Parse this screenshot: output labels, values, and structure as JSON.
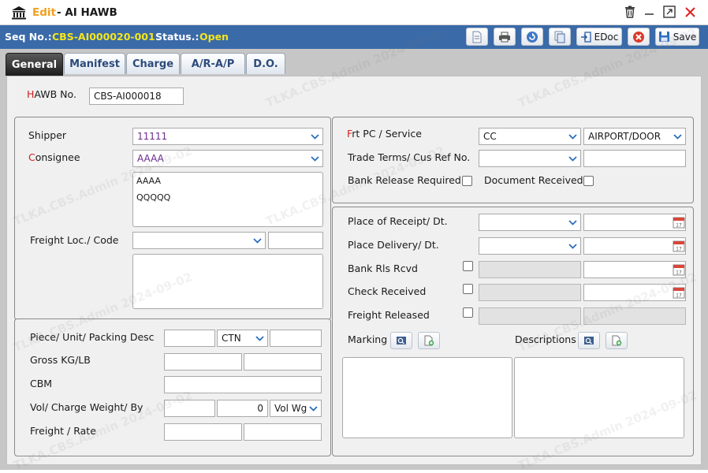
{
  "window": {
    "mode_label": "Edit",
    "title_sep": " - ",
    "title": "AI HAWB",
    "icon": "bank-icon"
  },
  "window_controls": {
    "delete_icon": "trash-icon",
    "minimize_icon": "minimize-icon",
    "maximize_icon": "maximize-icon",
    "close_icon": "close-icon"
  },
  "seqbar": {
    "seq_label": "Seq No.:",
    "seq_value": "CBS-AI000020-001",
    "status_label": "Status.:",
    "status_value": "Open"
  },
  "toolbar": {
    "edoc_label": "EDoc",
    "save_label": "Save"
  },
  "tabs": [
    {
      "label": "General",
      "active": true
    },
    {
      "label": "Manifest"
    },
    {
      "label": "Charge"
    },
    {
      "label": "A/R-A/P"
    },
    {
      "label": "D.O."
    }
  ],
  "hawb": {
    "label_first": "H",
    "label_rest": "AWB No.",
    "value": "CBS-AI000018"
  },
  "left": {
    "shipper_label": "Shipper",
    "shipper_value": "11111",
    "consignee_label_first": "C",
    "consignee_label_rest": "onsignee",
    "consignee_value": "AAAA",
    "consignee_address": [
      "AAAA",
      "QQQQQ"
    ],
    "freight_loc_label": "Freight Loc./ Code",
    "freight_loc_value": "",
    "freight_code_value": ""
  },
  "cargo": {
    "piece_label": "Piece/  Unit/  Packing Desc",
    "piece_value": "",
    "unit_value": "CTN",
    "packing_value": "",
    "gross_label": "Gross  KG/LB",
    "cbm_label": "CBM",
    "vol_label": "Vol/  Charge Weight/  By",
    "charge_weight": "0",
    "by_value": "Vol Wg",
    "freight_rate_label": "Freight / Rate"
  },
  "right": {
    "frt_label_first": "F",
    "frt_label_rest": "rt PC / Service",
    "frt_pc_value": "CC",
    "service_value": "AIRPORT/DOOR",
    "trade_terms_label": "Trade Terms/ Cus Ref No.",
    "bank_release_label": "Bank Release Required",
    "doc_received_label": "Document Received",
    "place_receipt_label": "Place of Receipt/ Dt.",
    "place_delivery_label": "Place Delivery/ Dt.",
    "bank_rls_label": "Bank Rls Rcvd",
    "check_received_label": "Check Received",
    "freight_released_label": "Freight Released",
    "marking_label": "Marking",
    "descriptions_label": "Descriptions"
  },
  "watermark": "TLKA.CBS.Admin 2024-09-02",
  "colors": {
    "seqbar_bg": "#3a6aa8",
    "status_yellow": "#f5e71a",
    "edit_orange": "#f0a020",
    "required_red": "#d02020",
    "consignee_purple": "#6b2a8e"
  }
}
